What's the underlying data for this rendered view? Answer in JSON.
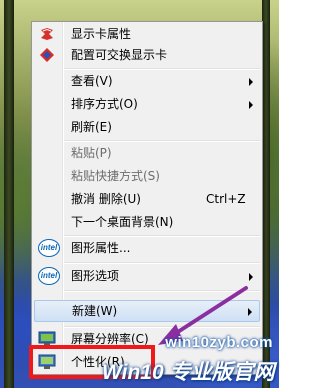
{
  "menu": {
    "items": [
      {
        "label": "显示卡属性",
        "icon": "display-adapter-icon"
      },
      {
        "label": "配置可交换显示卡",
        "icon": "switchable-graphics-icon"
      },
      {
        "label": "查看(V)",
        "submenu": true
      },
      {
        "label": "排序方式(O)",
        "submenu": true
      },
      {
        "label": "刷新(E)"
      },
      {
        "label": "粘贴(P)",
        "disabled": true
      },
      {
        "label": "粘贴快捷方式(S)",
        "disabled": true
      },
      {
        "label": "撤消 删除(U)",
        "shortcut": "Ctrl+Z"
      },
      {
        "label": "下一个桌面背景(N)"
      },
      {
        "label": "图形属性...",
        "icon": "intel-icon"
      },
      {
        "label": "图形选项",
        "icon": "intel-icon",
        "submenu": true
      },
      {
        "label": "新建(W)",
        "submenu": true,
        "highlighted": true
      },
      {
        "label": "屏幕分辨率(C)",
        "icon": "screen-resolution-icon"
      },
      {
        "label": "个性化(R)",
        "icon": "personalize-icon"
      }
    ],
    "intel_text": "intel"
  },
  "watermark": {
    "url": "win10zyb.com",
    "brand": "Win10 专业版官网"
  },
  "colors": {
    "highlight_box": "#f01818",
    "arrow": "#8b2fa0"
  }
}
